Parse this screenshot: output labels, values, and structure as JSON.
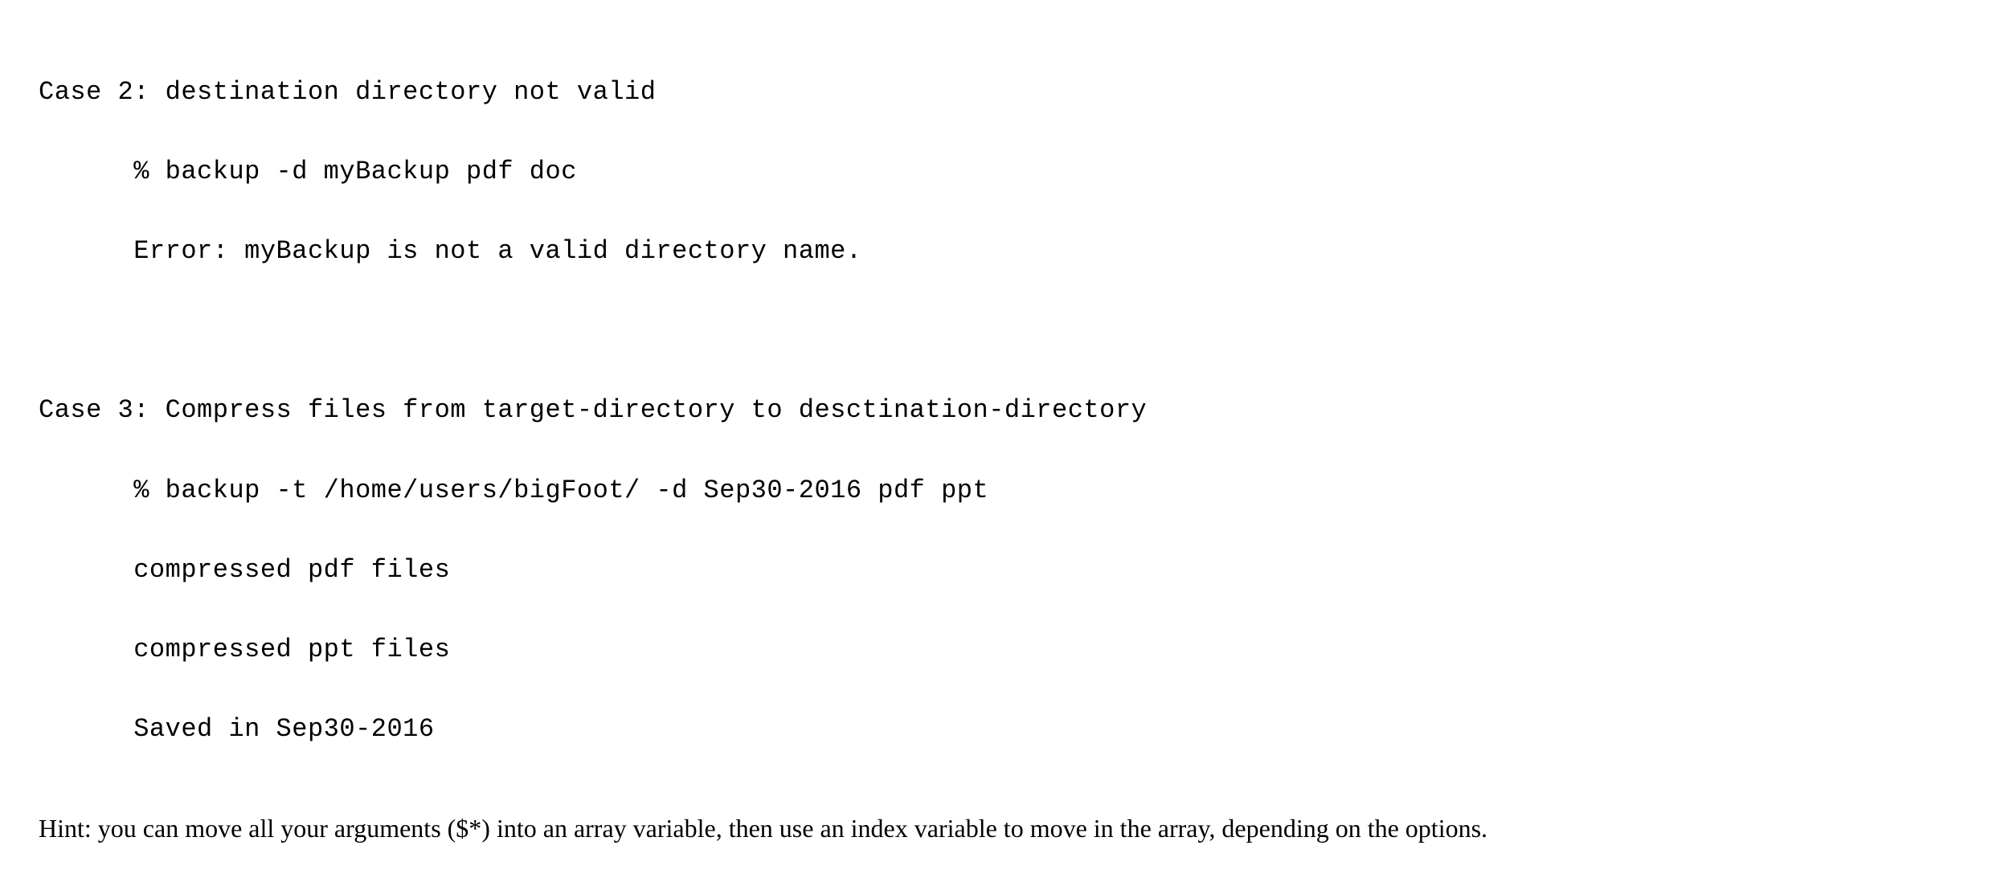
{
  "case2": {
    "title": "Case 2: destination directory not valid",
    "cmd": "      % backup -d myBackup pdf doc",
    "err": "      Error: myBackup is not a valid directory name."
  },
  "case3": {
    "title": "Case 3: Compress files from target-directory to desctination-directory",
    "cmd": "      % backup -t /home/users/bigFoot/ -d Sep30-2016 pdf ppt",
    "out1": "      compressed pdf files",
    "out2": "      compressed ppt files",
    "out3": "      Saved in Sep30-2016"
  },
  "hint": "Hint: you can move all your arguments ($*) into an array variable, then use an index variable to move in the array, depending on the options."
}
